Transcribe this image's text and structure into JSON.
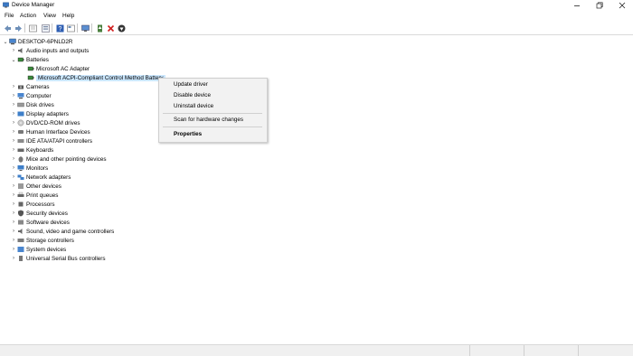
{
  "window": {
    "title": "Device Manager"
  },
  "menu": [
    "File",
    "Action",
    "View",
    "Help"
  ],
  "toolbar": {
    "icons": [
      "back-arrow-icon",
      "forward-arrow-icon",
      "properties-sheet-icon",
      "console-tree-icon",
      "help-icon",
      "view-icon",
      "monitor-icon",
      "update-driver-icon",
      "uninstall-icon",
      "enable-device-icon"
    ]
  },
  "tree": {
    "root": "DESKTOP-6PNLD2R",
    "items": [
      {
        "label": "Audio inputs and outputs",
        "state": "collapsed"
      },
      {
        "label": "Batteries",
        "state": "expanded"
      },
      {
        "label": "Microsoft AC Adapter",
        "state": "child"
      },
      {
        "label": "Microsoft ACPI-Compliant Control Method Battery",
        "state": "child-selected"
      },
      {
        "label": "Cameras",
        "state": "collapsed"
      },
      {
        "label": "Computer",
        "state": "collapsed"
      },
      {
        "label": "Disk drives",
        "state": "collapsed"
      },
      {
        "label": "Display adapters",
        "state": "collapsed"
      },
      {
        "label": "DVD/CD-ROM drives",
        "state": "collapsed"
      },
      {
        "label": "Human Interface Devices",
        "state": "collapsed"
      },
      {
        "label": "IDE ATA/ATAPI controllers",
        "state": "collapsed"
      },
      {
        "label": "Keyboards",
        "state": "collapsed"
      },
      {
        "label": "Mice and other pointing devices",
        "state": "collapsed"
      },
      {
        "label": "Monitors",
        "state": "collapsed"
      },
      {
        "label": "Network adapters",
        "state": "collapsed"
      },
      {
        "label": "Other devices",
        "state": "collapsed"
      },
      {
        "label": "Print queues",
        "state": "collapsed"
      },
      {
        "label": "Processors",
        "state": "collapsed"
      },
      {
        "label": "Security devices",
        "state": "collapsed"
      },
      {
        "label": "Software devices",
        "state": "collapsed"
      },
      {
        "label": "Sound, video and game controllers",
        "state": "collapsed"
      },
      {
        "label": "Storage controllers",
        "state": "collapsed"
      },
      {
        "label": "System devices",
        "state": "collapsed"
      },
      {
        "label": "Universal Serial Bus controllers",
        "state": "collapsed"
      }
    ]
  },
  "context_menu": {
    "update_driver": "Update driver",
    "disable_device": "Disable device",
    "uninstall_device": "Uninstall device",
    "scan": "Scan for hardware changes",
    "properties": "Properties"
  },
  "colors": {
    "selection": "#cce8ff",
    "menu_bg": "#f2f2f2"
  }
}
